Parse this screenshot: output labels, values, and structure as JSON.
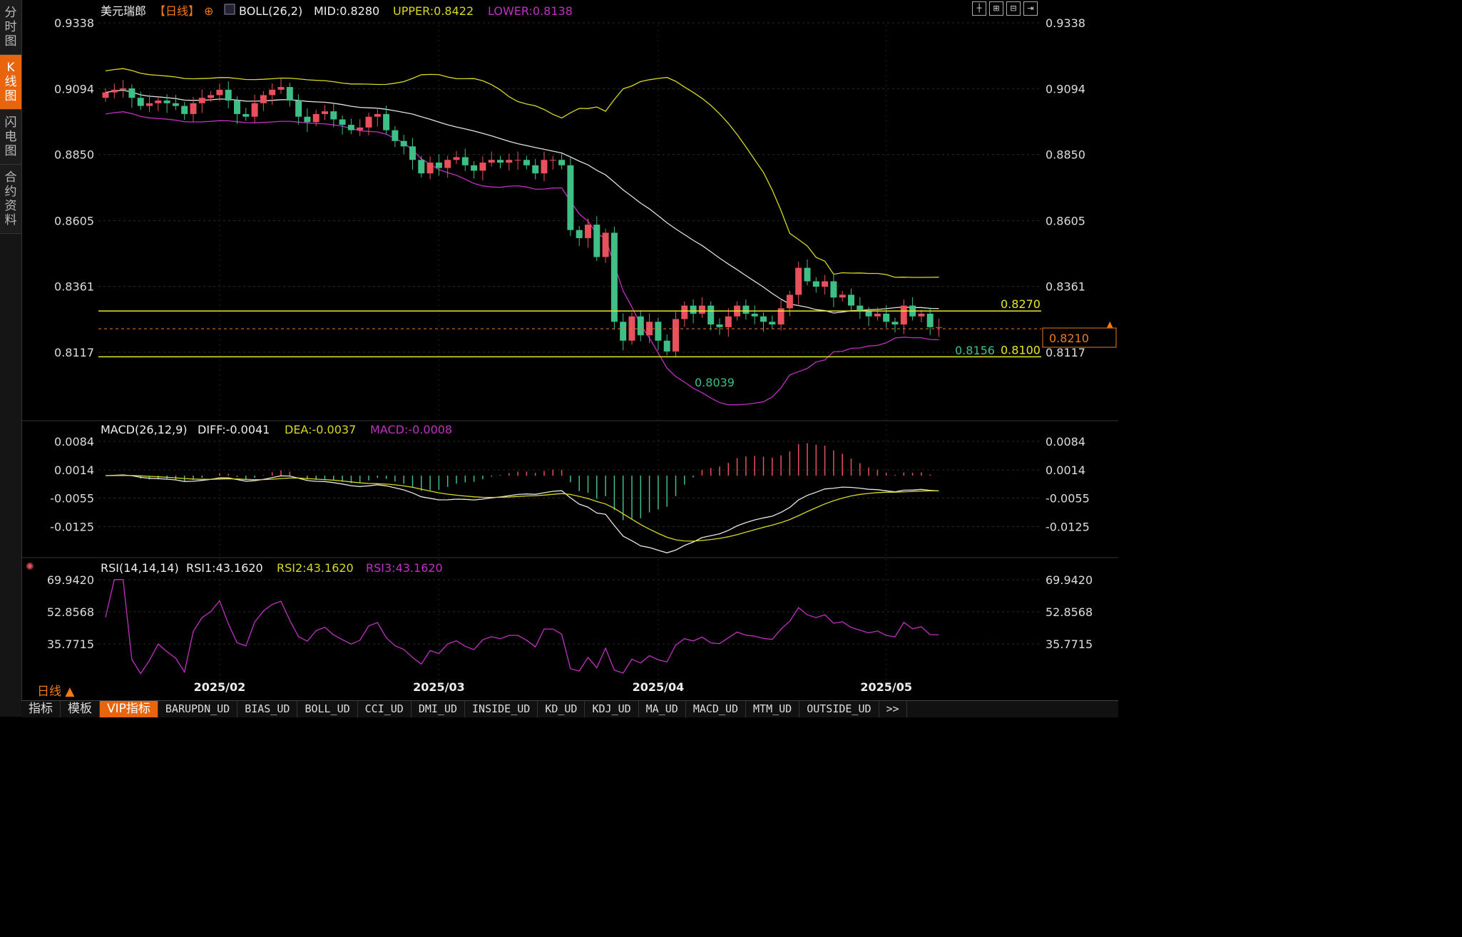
{
  "sidebar": {
    "tabs": [
      {
        "label": "分\n时\n图"
      },
      {
        "label": "K\n线\n图"
      },
      {
        "label": "闪\n电\n图"
      },
      {
        "label": "合\n约\n资\n料"
      }
    ]
  },
  "header": {
    "symbol": "美元瑞郎",
    "period_tag": "【日线】",
    "boll": "BOLL(26,2)",
    "mid": "MID:0.8280",
    "upper": "UPPER:0.8422",
    "lower": "LOWER:0.8138"
  },
  "macd_header": {
    "name": "MACD(26,12,9)",
    "diff": "DIFF:-0.0041",
    "dea": "DEA:-0.0037",
    "macd": "MACD:-0.0008"
  },
  "rsi_header": {
    "name": "RSI(14,14,14)",
    "rsi1": "RSI1:43.1620",
    "rsi2": "RSI2:43.1620",
    "rsi3": "RSI3:43.1620"
  },
  "colors": {
    "up": "#e8505b",
    "down": "#3dbf86",
    "boll_upper": "#d8d820",
    "boll_mid": "#e0e0e0",
    "boll_lower": "#c030c0",
    "accent": "#e8650d"
  },
  "chart_data": [
    {
      "type": "candlestick",
      "ylim": [
        0.8117,
        0.9338
      ],
      "y_ticks": [
        "0.9338",
        "0.9094",
        "0.8850",
        "0.8605",
        "0.8361",
        "0.8117"
      ],
      "x_labels": [
        "2025/02",
        "2025/03",
        "2025/04",
        "2025/05"
      ],
      "x_label_index": [
        13,
        38,
        63,
        89
      ],
      "closes": [
        0.908,
        0.909,
        0.9095,
        0.906,
        0.903,
        0.904,
        0.905,
        0.904,
        0.903,
        0.9,
        0.904,
        0.906,
        0.907,
        0.909,
        0.905,
        0.9,
        0.899,
        0.904,
        0.907,
        0.909,
        0.91,
        0.905,
        0.899,
        0.897,
        0.9,
        0.901,
        0.898,
        0.896,
        0.894,
        0.895,
        0.899,
        0.9,
        0.894,
        0.89,
        0.888,
        0.883,
        0.878,
        0.882,
        0.88,
        0.883,
        0.884,
        0.881,
        0.879,
        0.882,
        0.883,
        0.882,
        0.883,
        0.883,
        0.881,
        0.878,
        0.883,
        0.883,
        0.881,
        0.857,
        0.854,
        0.859,
        0.847,
        0.856,
        0.823,
        0.816,
        0.825,
        0.818,
        0.823,
        0.816,
        0.812,
        0.824,
        0.829,
        0.826,
        0.829,
        0.822,
        0.821,
        0.825,
        0.829,
        0.826,
        0.825,
        0.823,
        0.822,
        0.828,
        0.833,
        0.843,
        0.838,
        0.836,
        0.838,
        0.832,
        0.833,
        0.829,
        0.827,
        0.825,
        0.826,
        0.823,
        0.822,
        0.829,
        0.825,
        0.826,
        0.821,
        0.821
      ],
      "hlines": [
        {
          "value": 0.827,
          "label": "0.8270"
        },
        {
          "value": 0.81,
          "label": "0.8100"
        }
      ],
      "current_price": "0.8210",
      "annotations": [
        {
          "label": "0.8039",
          "value": 0.8039
        },
        {
          "label": "0.8156",
          "value": 0.8156
        }
      ]
    },
    {
      "type": "bar+line",
      "name": "MACD",
      "y_ticks": [
        "0.0084",
        "0.0014",
        "-0.0055",
        "-0.0125"
      ]
    },
    {
      "type": "line",
      "name": "RSI",
      "y_ticks": [
        "69.9420",
        "52.8568",
        "35.7715"
      ]
    }
  ],
  "period_label": "日线",
  "bottom_tabs": [
    "指标",
    "模板",
    "VIP指标",
    "BARUPDN_UD",
    "BIAS_UD",
    "BOLL_UD",
    "CCI_UD",
    "DMI_UD",
    "INSIDE_UD",
    "KD_UD",
    "KDJ_UD",
    "MA_UD",
    "MACD_UD",
    "MTM_UD",
    "OUTSIDE_UD",
    ">>"
  ]
}
